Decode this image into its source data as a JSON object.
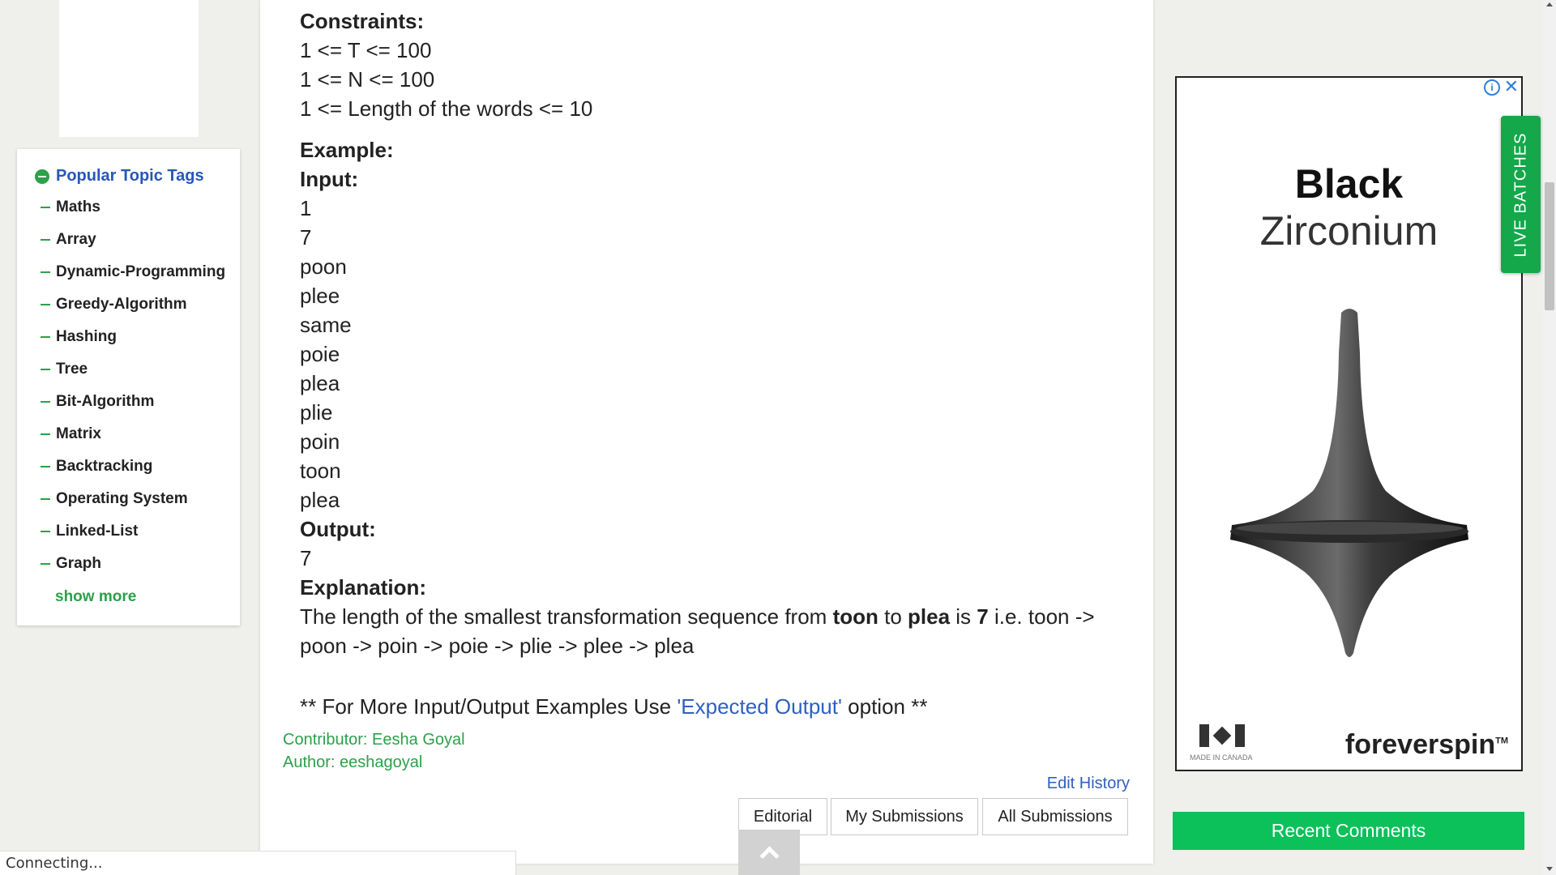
{
  "sidebar": {
    "header": "Popular Topic Tags",
    "tags": [
      "Maths",
      "Array",
      "Dynamic-Programming",
      "Greedy-Algorithm",
      "Hashing",
      "Tree",
      "Bit-Algorithm",
      "Matrix",
      "Backtracking",
      "Operating System",
      "Linked-List",
      "Graph"
    ],
    "show_more": "show more"
  },
  "problem": {
    "constraints_heading": "Constraints:",
    "constraints": [
      "1 <= T <= 100",
      "1 <= N <= 100",
      "1 <= Length of the words <= 10"
    ],
    "example_heading": "Example:",
    "input_heading": "Input:",
    "input_lines": [
      "1",
      "7",
      "poon",
      "plee",
      "same",
      "poie",
      "plea",
      "plie",
      "poin",
      "toon",
      "plea"
    ],
    "output_heading": "Output:",
    "output_lines": [
      "7"
    ],
    "explanation_heading": "Explanation:",
    "explanation": {
      "p1": "The length of the smallest transformation sequence from ",
      "w1": "toon",
      "p2": " to ",
      "w2": "plea",
      "p3": " is ",
      "w3": "7",
      "p4": " i.e. toon ->",
      "line2": "poon -> poin -> poie -> plie -> plee -> plea"
    },
    "more": {
      "prefix": "** For More Input/Output Examples Use ",
      "link": "'Expected Output'",
      "suffix": " option **"
    },
    "contributor": "Contributor: Eesha Goyal",
    "author": "Author: eeshagoyal",
    "edit_history": "Edit History",
    "buttons": {
      "editorial": "Editorial",
      "my_submissions": "My Submissions",
      "all_submissions": "All Submissions"
    }
  },
  "status_bar": "Connecting...",
  "ad": {
    "title1": "Black",
    "title2": "Zirconium",
    "info": "i",
    "close": "✕",
    "made_in": "MADE IN CANADA",
    "brand": "foreverspin",
    "tm": "TM"
  },
  "live_batches": "LIVE BATCHES",
  "recent_comments": "Recent Comments"
}
